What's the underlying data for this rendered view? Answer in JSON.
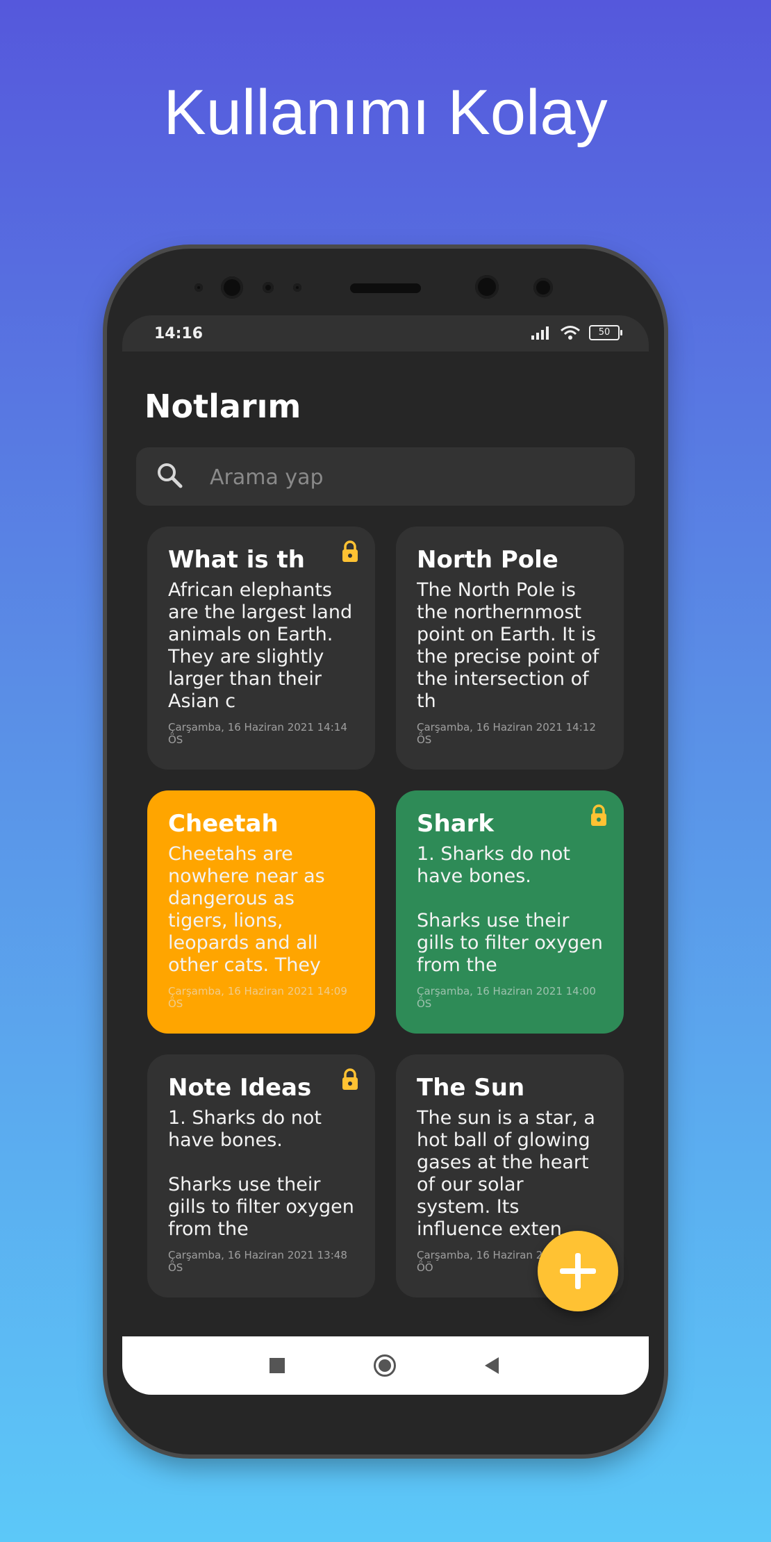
{
  "headline": "Kullanımı Kolay",
  "status": {
    "time": "14:16",
    "battery": "50"
  },
  "app": {
    "title": "Notlarım"
  },
  "search": {
    "placeholder": "Arama yap"
  },
  "notes": [
    {
      "title": "What is th",
      "body": "African elephants are the largest land animals on Earth. They are slightly larger than their Asian c",
      "date": "Çarşamba, 16 Haziran 2021 14:14 ÖS",
      "color": "#323232",
      "locked": true
    },
    {
      "title": "North Pole",
      "body": "The North Pole is the northernmost point on Earth. It is the precise point of the intersection of th",
      "date": "Çarşamba, 16 Haziran 2021 14:12 ÖS",
      "color": "#323232",
      "locked": false
    },
    {
      "title": "Cheetah",
      "body": "Cheetahs are nowhere near as dangerous as tigers, lions, leopards and all other cats. They",
      "date": "Çarşamba, 16 Haziran 2021 14:09 ÖS",
      "color": "#FFA500",
      "locked": false
    },
    {
      "title": "Shark",
      "body": "1. Sharks do not have bones.\n\nSharks use their gills to filter oxygen from the",
      "date": "Çarşamba, 16 Haziran 2021 14:00 ÖS",
      "color": "#2E8B57",
      "locked": true
    },
    {
      "title": "Note Ideas",
      "body": "1. Sharks do not have bones.\n\nSharks use their gills to filter oxygen from the",
      "date": "Çarşamba, 16 Haziran 2021 13:48 ÖS",
      "color": "#323232",
      "locked": true
    },
    {
      "title": "The Sun",
      "body": "The sun is a star, a hot ball of glowing gases at the heart of our solar system. Its influence exten",
      "date": "Çarşamba, 16 Haziran 2021 1",
      "date_suffix": "ÖÖ",
      "color": "#323232",
      "locked": false
    }
  ],
  "colors": {
    "lock": "#FFC233",
    "fab": "#FFC233",
    "background": "#262626"
  },
  "icons": {
    "search": "search-icon",
    "lock": "lock-icon",
    "fab": "plus-icon"
  }
}
